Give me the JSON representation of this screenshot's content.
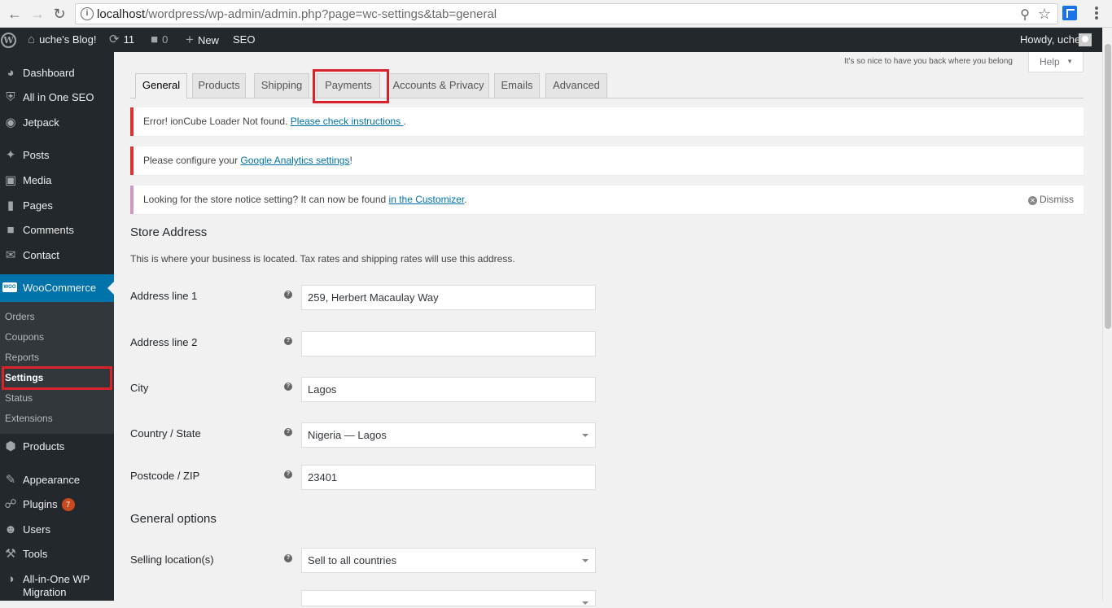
{
  "browser": {
    "url_host": "localhost",
    "url_path": "/wordpress/wp-admin/admin.php?page=wc-settings&tab=general"
  },
  "adminbar": {
    "site_name": "uche's Blog!",
    "updates_count": "11",
    "comments_count": "0",
    "new_label": "New",
    "seo_label": "SEO",
    "howdy": "Howdy, uche"
  },
  "sidebar": {
    "items": [
      {
        "label": "Dashboard",
        "icon": "dashboard-icon"
      },
      {
        "label": "All in One SEO",
        "icon": "shield-icon"
      },
      {
        "label": "Jetpack",
        "icon": "jetpack-icon"
      },
      {
        "label": "Posts",
        "icon": "pin-icon"
      },
      {
        "label": "Media",
        "icon": "media-icon"
      },
      {
        "label": "Pages",
        "icon": "pages-icon"
      },
      {
        "label": "Comments",
        "icon": "comment-icon"
      },
      {
        "label": "Contact",
        "icon": "mail-icon"
      },
      {
        "label": "WooCommerce",
        "icon": "woo-icon"
      },
      {
        "label": "Products",
        "icon": "box-icon"
      },
      {
        "label": "Appearance",
        "icon": "brush-icon"
      },
      {
        "label": "Plugins",
        "icon": "plug-icon",
        "badge": "7"
      },
      {
        "label": "Users",
        "icon": "user-icon"
      },
      {
        "label": "Tools",
        "icon": "wrench-icon"
      },
      {
        "label": "All-in-One WP",
        "label2": "Migration",
        "icon": "migration-icon"
      }
    ],
    "submenu": [
      "Orders",
      "Coupons",
      "Reports",
      "Settings",
      "Status",
      "Extensions"
    ]
  },
  "main": {
    "greeting": "It's so nice to have you back where you belong",
    "help_label": "Help",
    "tabs": [
      "General",
      "Products",
      "Shipping",
      "Payments",
      "Accounts & Privacy",
      "Emails",
      "Advanced"
    ],
    "notices": [
      {
        "text": "Error! ionCube Loader Not found. ",
        "link": "Please check instructions ",
        "after": "."
      },
      {
        "text": "Please configure your ",
        "link": "Google Analytics settings",
        "after": "!"
      },
      {
        "text": "Looking for the store notice setting? It can now be found ",
        "link": "in the Customizer",
        "after": ".",
        "dismiss": "Dismiss"
      }
    ],
    "store_address": {
      "heading": "Store Address",
      "description": "This is where your business is located. Tax rates and shipping rates will use this address.",
      "fields": [
        {
          "label": "Address line 1",
          "value": "259, Herbert Macaulay Way"
        },
        {
          "label": "Address line 2",
          "value": ""
        },
        {
          "label": "City",
          "value": "Lagos"
        },
        {
          "label": "Country / State",
          "value": "Nigeria — Lagos"
        },
        {
          "label": "Postcode / ZIP",
          "value": "23401"
        }
      ]
    },
    "general_options": {
      "heading": "General options",
      "fields": [
        {
          "label": "Selling location(s)",
          "value": "Sell to all countries"
        }
      ]
    }
  },
  "colors": {
    "admin_dark": "#23282d",
    "accent": "#0073aa",
    "error": "#dc3232",
    "highlight_box": "#d9222a"
  }
}
